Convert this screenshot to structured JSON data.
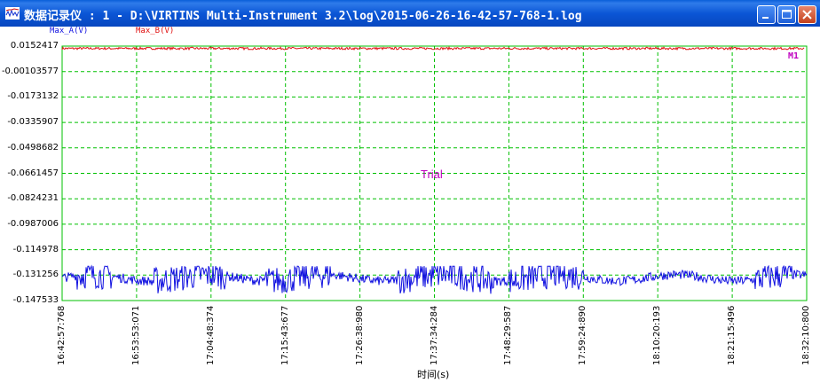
{
  "window": {
    "title": "数据记录仪 : 1 - D:\\VIRTINS Multi-Instrument 3.2\\log\\2015-06-26-16-42-57-768-1.log",
    "buttons": {
      "minimize": "minimize",
      "maximize": "maximize",
      "close": "close"
    }
  },
  "colors": {
    "series_a": "#1010e0",
    "series_b": "#e01010",
    "grid": "#00c000",
    "watermark": "#c000c0"
  },
  "watermark_text": "Trial",
  "marker_label": "M1",
  "chart_data": {
    "type": "line",
    "xlabel": "时间(s)",
    "ylabel": "",
    "grid": true,
    "legend_position": "top-left",
    "series": [
      {
        "name": "Max_A(V)",
        "color": "#1010e0",
        "approx_level": -0.131,
        "range": [
          -0.145,
          -0.1255
        ]
      },
      {
        "name": "Max_B(V)",
        "color": "#e01010",
        "approx_level": 0.0137,
        "range": [
          0.013,
          0.0145
        ]
      }
    ],
    "ylim": [
      -0.147533,
      0.0152417
    ],
    "y_ticks": [
      "0.0152417",
      "-0.00103577",
      "-0.0173132",
      "-0.0335907",
      "-0.0498682",
      "-0.0661457",
      "-0.0824231",
      "-0.0987006",
      "-0.114978",
      "-0.131256",
      "-0.147533"
    ],
    "x_ticks": [
      "16:42:57:768",
      "16:53:53:071",
      "17:04:48:374",
      "17:15:43:677",
      "17:26:38:980",
      "17:37:34:284",
      "17:48:29:587",
      "17:59:24:890",
      "18:10:20:193",
      "18:21:15:496",
      "18:32:10:800"
    ],
    "xlim": [
      "16:42:57:768",
      "18:32:10:800"
    ]
  }
}
